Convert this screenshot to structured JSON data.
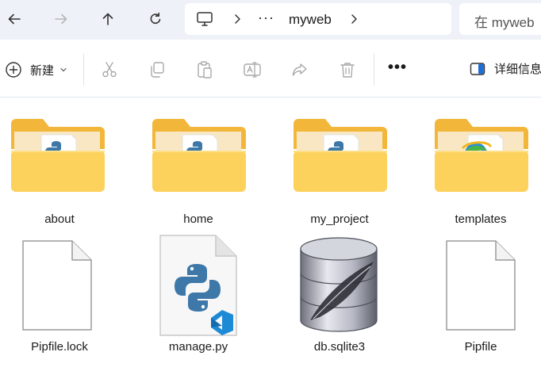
{
  "nav": {
    "back_icon": "arrow-left-icon",
    "forward_icon": "arrow-right-icon",
    "up_icon": "arrow-up-icon",
    "refresh_icon": "refresh-icon"
  },
  "breadcrumb": {
    "root_icon": "computer-icon",
    "overflow": "···",
    "current": "myweb"
  },
  "search": {
    "placeholder": "在 myweb"
  },
  "toolbar": {
    "new_label": "新建",
    "more_label": "•••",
    "details_label": "详细信息"
  },
  "items": [
    {
      "name": "about",
      "type": "folder",
      "preview": "python"
    },
    {
      "name": "home",
      "type": "folder",
      "preview": "python"
    },
    {
      "name": "my_project",
      "type": "folder",
      "preview": "python"
    },
    {
      "name": "templates",
      "type": "folder",
      "preview": "edge"
    },
    {
      "name": "Pipfile.lock",
      "type": "file",
      "icon": "blank-file-icon"
    },
    {
      "name": "manage.py",
      "type": "file",
      "icon": "python-file-icon"
    },
    {
      "name": "db.sqlite3",
      "type": "file",
      "icon": "database-icon"
    },
    {
      "name": "Pipfile",
      "type": "file",
      "icon": "blank-file-icon"
    }
  ],
  "colors": {
    "folder_back": "#f2b73a",
    "folder_front": "#fcd15c",
    "python_blue": "#3d78a8",
    "python_yellow": "#f5c93b",
    "vscode_blue": "#1d8ad6"
  }
}
